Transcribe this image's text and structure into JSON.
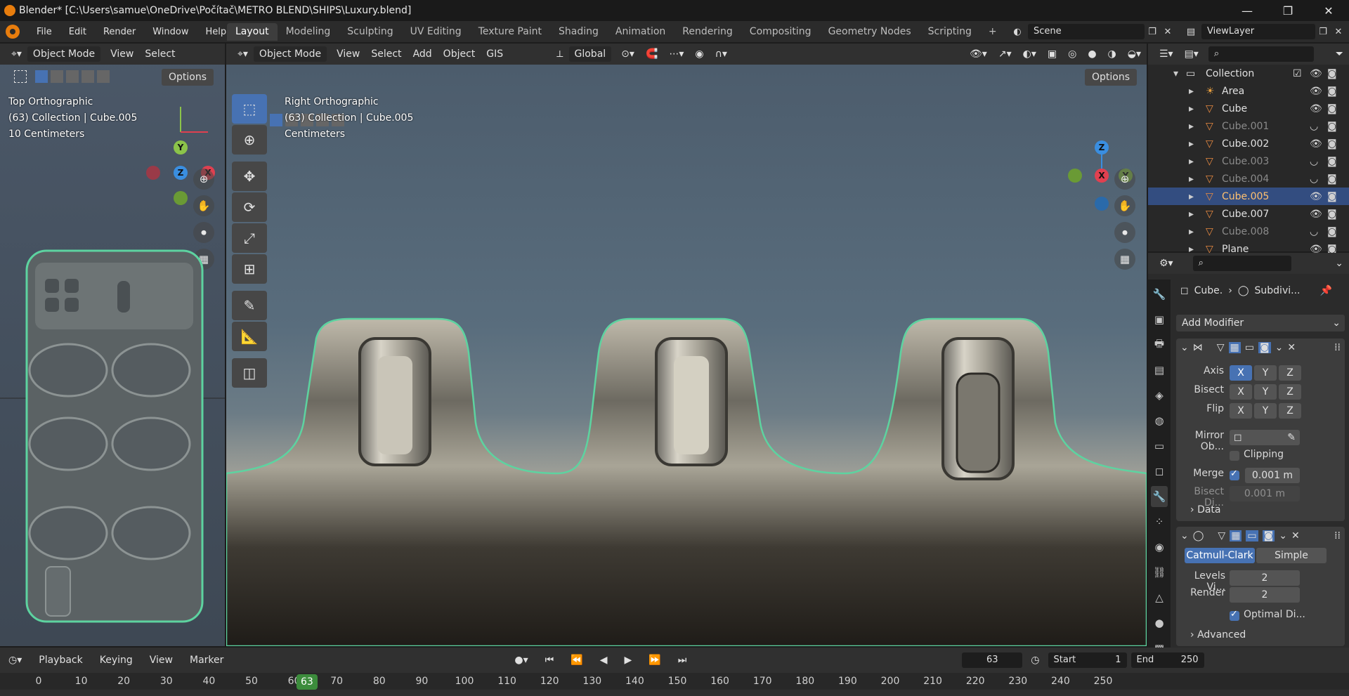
{
  "window": {
    "title": "Blender* [C:\\Users\\samue\\OneDrive\\Počítač\\METRO BLEND\\SHIPS\\Luxury.blend]",
    "minimize": "—",
    "maximize": "❐",
    "close": "✕"
  },
  "menu": [
    "File",
    "Edit",
    "Render",
    "Window",
    "Help"
  ],
  "workspaces": [
    "Layout",
    "Modeling",
    "Sculpting",
    "UV Editing",
    "Texture Paint",
    "Shading",
    "Animation",
    "Rendering",
    "Compositing",
    "Geometry Nodes",
    "Scripting",
    "+"
  ],
  "active_workspace": "Layout",
  "scene": "Scene",
  "view_layer": "ViewLayer",
  "left_viewport": {
    "mode": "Object Mode",
    "view": "View",
    "select": "Select",
    "options": "Options",
    "info": [
      "Top Orthographic",
      "(63) Collection | Cube.005",
      "10 Centimeters"
    ]
  },
  "main_viewport": {
    "mode": "Object Mode",
    "menus": [
      "View",
      "Select",
      "Add",
      "Object",
      "GIS"
    ],
    "orientation": "Global",
    "options": "Options",
    "info": [
      "Right Orthographic",
      "(63) Collection | Cube.005",
      "Centimeters"
    ]
  },
  "outliner": {
    "collection": "Collection",
    "items": [
      {
        "name": "Area",
        "visible": true,
        "type": "light"
      },
      {
        "name": "Cube",
        "visible": true,
        "type": "mesh"
      },
      {
        "name": "Cube.001",
        "visible": false,
        "type": "mesh"
      },
      {
        "name": "Cube.002",
        "visible": true,
        "type": "mesh"
      },
      {
        "name": "Cube.003",
        "visible": false,
        "type": "mesh"
      },
      {
        "name": "Cube.004",
        "visible": false,
        "type": "mesh"
      },
      {
        "name": "Cube.005",
        "visible": true,
        "type": "mesh",
        "selected": true
      },
      {
        "name": "Cube.007",
        "visible": true,
        "type": "mesh"
      },
      {
        "name": "Cube.008",
        "visible": false,
        "type": "mesh"
      },
      {
        "name": "Plane",
        "visible": true,
        "type": "mesh"
      }
    ]
  },
  "properties": {
    "breadcrumb_object": "Cube.",
    "breadcrumb_modifier": "Subdivi...",
    "add_modifier": "Add Modifier",
    "mirror": {
      "axis_label": "Axis",
      "bisect_label": "Bisect",
      "flip_label": "Flip",
      "xyz": [
        "X",
        "Y",
        "Z"
      ],
      "mirror_object_label": "Mirror Ob...",
      "clipping_label": "Clipping",
      "merge_label": "Merge",
      "merge_value": "0.001 m",
      "bisect_dist_label": "Bisect Di...",
      "bisect_dist_value": "0.001 m",
      "data_label": "Data"
    },
    "subdivision": {
      "catmull": "Catmull-Clark",
      "simple": "Simple",
      "levels_label": "Levels Vi...",
      "levels_value": "2",
      "render_label": "Render",
      "render_value": "2",
      "optimal_label": "Optimal Di...",
      "advanced_label": "Advanced"
    }
  },
  "timeline": {
    "menus": [
      "Playback",
      "Keying",
      "View",
      "Marker"
    ],
    "current_frame": "63",
    "start_label": "Start",
    "start_value": "1",
    "end_label": "End",
    "end_value": "250",
    "ruler": [
      "0",
      "10",
      "20",
      "30",
      "40",
      "50",
      "60",
      "70",
      "80",
      "90",
      "100",
      "110",
      "120",
      "130",
      "140",
      "150",
      "160",
      "170",
      "180",
      "190",
      "200",
      "210",
      "220",
      "230",
      "240",
      "250"
    ]
  }
}
